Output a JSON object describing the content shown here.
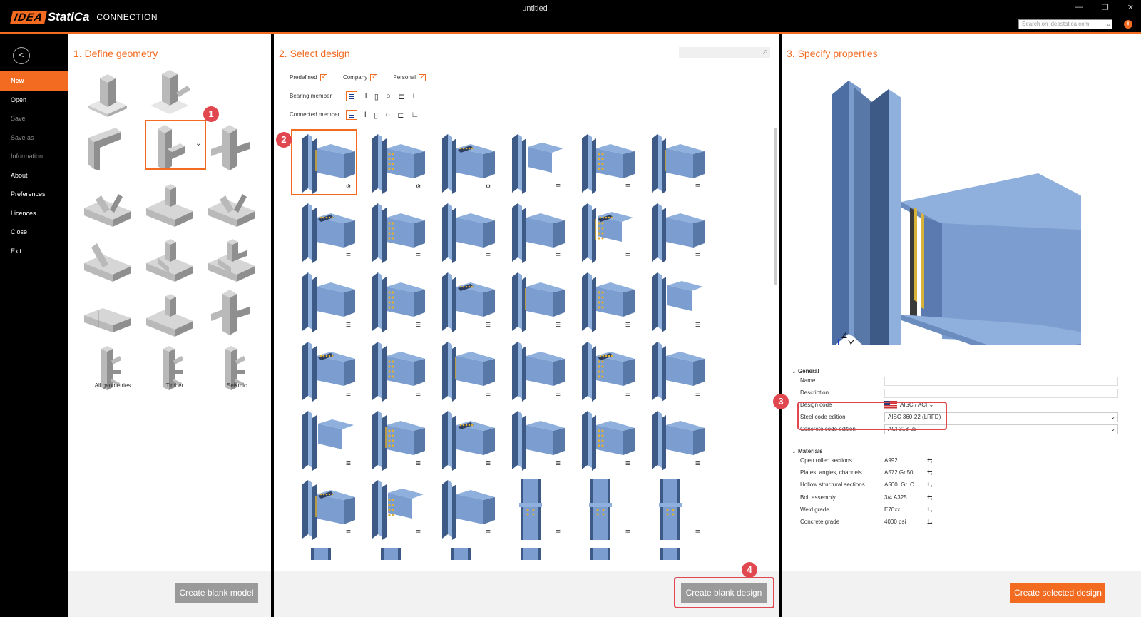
{
  "app": {
    "logo_idea": "IDEA",
    "logo_statica": "StatiCa",
    "product": "CONNECTION",
    "window_title": "untitled"
  },
  "top_search_placeholder": "Search on ideastatica.com",
  "sidebar": {
    "back_icon": "back-arrow-icon",
    "items": [
      {
        "label": "New",
        "active": true
      },
      {
        "label": "Open",
        "active": false
      },
      {
        "label": "Save",
        "active": false,
        "dim": true
      },
      {
        "label": "Save as",
        "active": false,
        "dim": true
      },
      {
        "label": "Information",
        "active": false,
        "dim": true
      },
      {
        "label": "About",
        "active": false
      },
      {
        "label": "Preferences",
        "active": false
      },
      {
        "label": "Licences",
        "active": false
      },
      {
        "label": "Close",
        "active": false
      },
      {
        "label": "Exit",
        "active": false
      }
    ]
  },
  "panel1": {
    "title": "1. Define geometry",
    "labels": {
      "all": "All geometries",
      "timber": "Timber",
      "seismic": "Seismic"
    },
    "create_button": "Create blank model"
  },
  "panel2": {
    "title": "2. Select design",
    "filters": {
      "predefined": "Predefined",
      "company": "Company",
      "personal": "Personal"
    },
    "bearing_member": "Bearing member",
    "connected_member": "Connected member",
    "create_button": "Create blank design"
  },
  "panel3": {
    "title": "3. Specify properties",
    "general": {
      "section": "General",
      "name_label": "Name",
      "description_label": "Description",
      "design_code_label": "Design code",
      "design_code_value": "AISC / ACI",
      "steel_code_label": "Steel code edition",
      "steel_code_value": "AISC 360-22 (LRFD)",
      "concrete_code_label": "Concrete code edition",
      "concrete_code_value": "ACI 318-25"
    },
    "materials": {
      "section": "Materials",
      "rows": [
        {
          "label": "Open rolled sections",
          "value": "A992"
        },
        {
          "label": "Plates, angles, channels",
          "value": "A572 Gr.50"
        },
        {
          "label": "Hollow structural sections",
          "value": "A500. Gr. C"
        },
        {
          "label": "Bolt assembly",
          "value": "3/4 A325"
        },
        {
          "label": "Weld grade",
          "value": "E70xx"
        },
        {
          "label": "Concrete grade",
          "value": "4000 psi"
        }
      ]
    },
    "axis_labels": {
      "z": "Z",
      "y": "Y",
      "x": "X"
    },
    "create_button": "Create selected design"
  },
  "badges": [
    "1",
    "2",
    "3",
    "4"
  ],
  "colors": {
    "accent": "#f26b21",
    "highlight": "#e0474f",
    "steel": "#6c8fc0"
  }
}
